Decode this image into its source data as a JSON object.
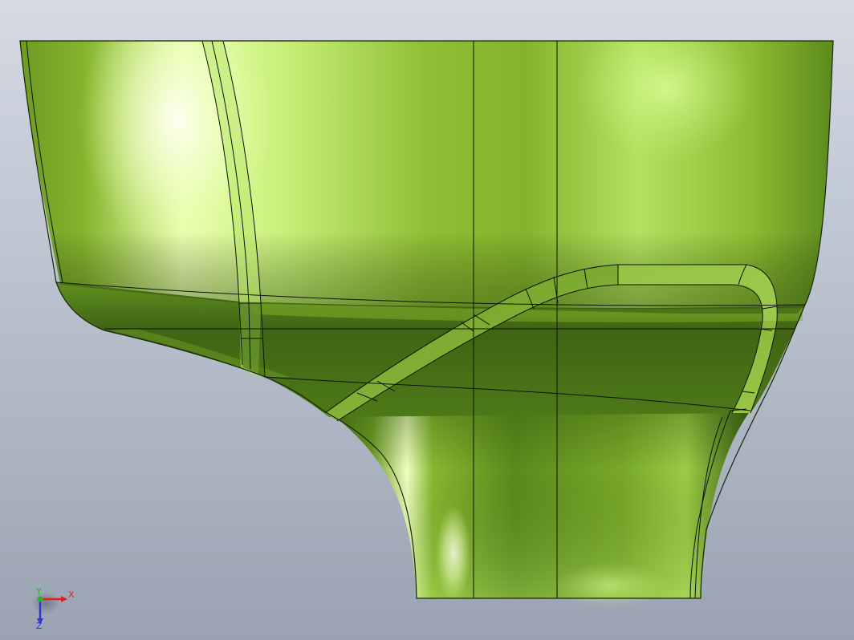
{
  "viewport": {
    "background_top": "#d5dae4",
    "background_bottom": "#9aa3b2"
  },
  "model": {
    "shade_light": "#f6ffd8",
    "shade_mid": "#8fbf34",
    "shade_dark": "#3f6414",
    "edge_color": "#0c1404"
  },
  "triad": {
    "x_label": "X",
    "y_label": "Y",
    "z_label": "Z",
    "x_color": "#e02222",
    "y_color": "#22b822",
    "z_color": "#2b38d6"
  }
}
